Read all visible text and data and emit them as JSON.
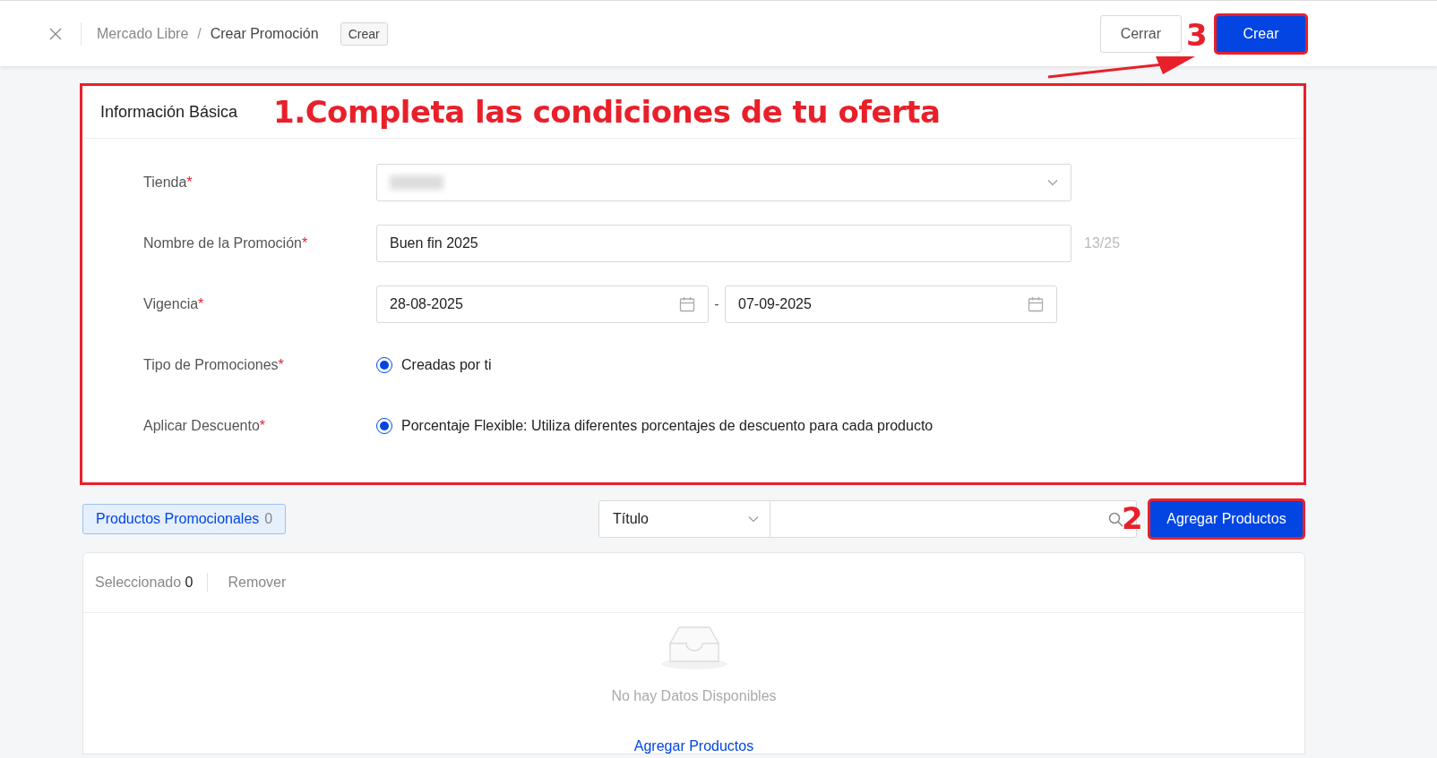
{
  "header": {
    "breadcrumb": [
      {
        "label": "Mercado Libre",
        "current": false
      },
      {
        "label": "Crear Promoción",
        "current": true
      }
    ],
    "separator": "/",
    "status_tag": "Crear",
    "buttons": [
      {
        "label": "Cerrar",
        "kind": "secondary"
      },
      {
        "label": "Crear",
        "kind": "primary"
      }
    ]
  },
  "form": {
    "title": "Información Básica",
    "fields": [
      {
        "kind": "select",
        "label": "Tienda",
        "required_mark": "*"
      },
      {
        "kind": "text",
        "label": "Nombre de la Promoción",
        "required_mark": "*",
        "value": "Buen fin 2025",
        "counter": "13/25"
      },
      {
        "kind": "daterange",
        "label": "Vigencia",
        "required_mark": "*",
        "start": "28-08-2025",
        "separator": "-",
        "end": "07-09-2025"
      },
      {
        "kind": "radio",
        "label": "Tipo de Promociones",
        "required_mark": "*",
        "options": [
          {
            "label": "Creadas por ti",
            "selected": true
          }
        ]
      },
      {
        "kind": "radio",
        "label": "Aplicar Descuento",
        "required_mark": "*",
        "options": [
          {
            "label": "Porcentaje Flexible: Utiliza diferentes porcentajes de descuento para cada producto",
            "selected": true
          }
        ]
      }
    ]
  },
  "products": {
    "tab": {
      "label": "Productos Promocionales",
      "count": "0",
      "selected": true
    },
    "filter_select": "Título",
    "add_button": "Agregar Productos",
    "toolbar": {
      "selected_label": "Seleccionado",
      "selected_count": "0",
      "remove": "Remover"
    },
    "empty": {
      "message": "No hay Datos Disponibles",
      "link": "Agregar Productos"
    }
  },
  "annotations": [
    {
      "kind": "heading",
      "text": "1.Completa las condiciones de tu oferta"
    },
    {
      "kind": "step",
      "text": "2"
    },
    {
      "kind": "step",
      "text": "3"
    }
  ]
}
